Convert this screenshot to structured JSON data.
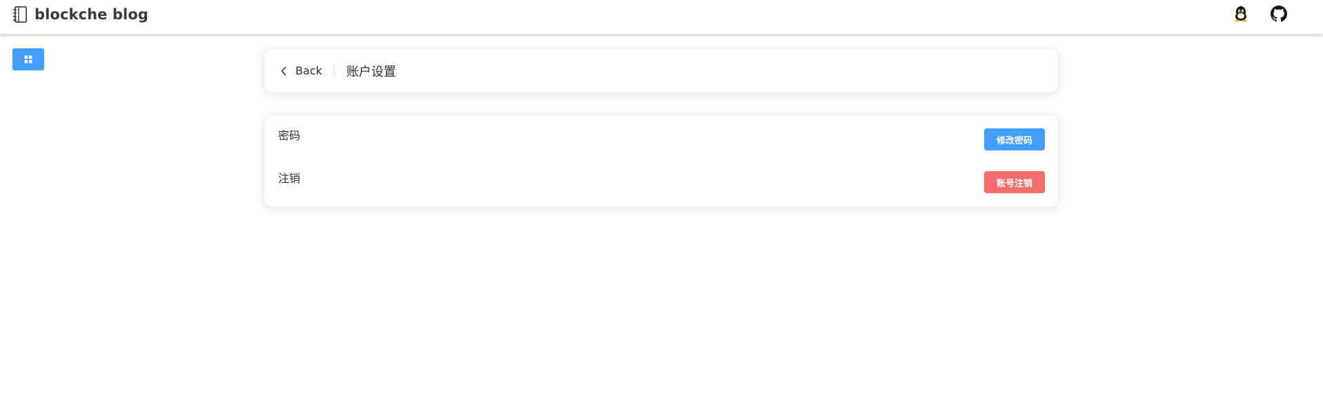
{
  "header": {
    "brand_icon": "notebook-icon",
    "brand_name": "blockche blog",
    "right_icons": [
      "qq-icon",
      "github-icon"
    ]
  },
  "sidebar_toggle": {
    "icon": "grid-icon"
  },
  "page_header": {
    "back_label": "Back",
    "title": "账户设置"
  },
  "settings": {
    "rows": [
      {
        "label": "密码",
        "button_label": "修改密码"
      },
      {
        "label": "注销",
        "button_label": "账号注销"
      }
    ]
  },
  "colors": {
    "primary": "#409eff",
    "danger": "#f56c6c",
    "text": "#303133"
  }
}
